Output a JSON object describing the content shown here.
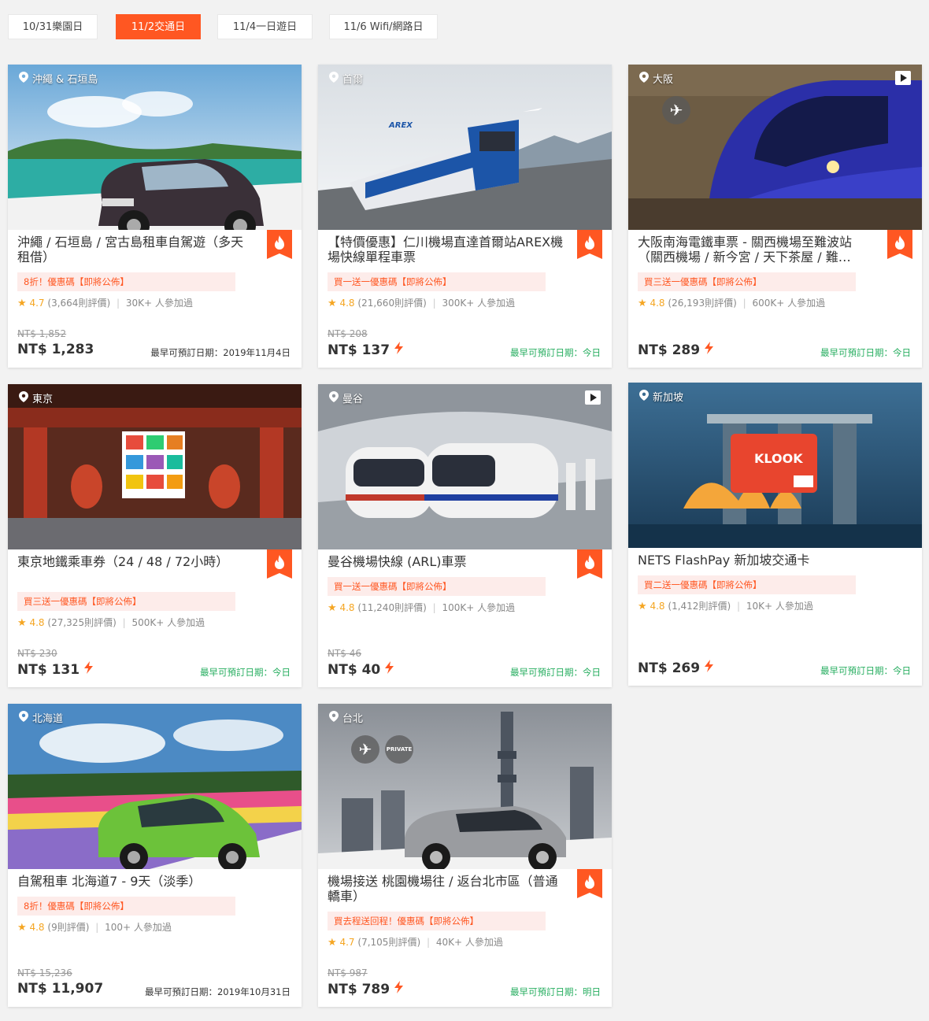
{
  "tabs": [
    {
      "label": "10/31樂園日",
      "active": false
    },
    {
      "label": "11/2交通日",
      "active": true
    },
    {
      "label": "11/4一日遊日",
      "active": false
    },
    {
      "label": "11/6 Wifi/網路日",
      "active": false
    }
  ],
  "colors": {
    "accent": "#ff5722",
    "promo_bg": "#fdecea",
    "star": "#f5a623",
    "green_date": "#27ae60"
  },
  "cards": [
    {
      "location": "沖繩 & 石垣島",
      "title": "沖繩 / 石垣島 / 宮古島租車自駕遊（多天租借）",
      "promo": "8折！優惠碼【即將公佈】",
      "score": "4.7",
      "reviews": "(3,664則評價)",
      "joined": "30K+ 人參加過",
      "old_price": "NT$ 1,852",
      "price": "NT$ 1,283",
      "instant": false,
      "date": "最早可預訂日期：2019年11月4日",
      "date_green": false,
      "hot": true,
      "video": false,
      "image_icon": "car-icon"
    },
    {
      "location": "首爾",
      "title": "【特價優惠】仁川機場直達首爾站AREX機場快線單程車票",
      "promo": "買一送一優惠碼【即將公佈】",
      "score": "4.8",
      "reviews": "(21,660則評價)",
      "joined": "300K+ 人參加過",
      "old_price": "NT$ 208",
      "price": "NT$ 137",
      "instant": true,
      "date": "最早可預訂日期：今日",
      "date_green": true,
      "hot": true,
      "video": false,
      "image_icon": "train-icon"
    },
    {
      "location": "大阪",
      "title": "大阪南海電鐵車票 - 關西機場至難波站（關西機場 / 新今宮 / 天下茶屋 / 難…",
      "promo": "買三送一優惠碼【即將公佈】",
      "score": "4.8",
      "reviews": "(26,193則評價)",
      "joined": "600K+ 人參加過",
      "old_price": "",
      "price": "NT$ 289",
      "instant": true,
      "date": "最早可預訂日期：今日",
      "date_green": true,
      "hot": true,
      "video": true,
      "image_icon": "train-icon"
    },
    {
      "location": "東京",
      "title": "東京地鐵乘車券（24 / 48 / 72小時）",
      "promo": "買三送一優惠碼【即將公佈】",
      "score": "4.8",
      "reviews": "(27,325則評價)",
      "joined": "500K+ 人參加過",
      "old_price": "NT$ 230",
      "price": "NT$ 131",
      "instant": true,
      "date": "最早可預訂日期：今日",
      "date_green": true,
      "hot": true,
      "video": false,
      "image_icon": "temple-icon"
    },
    {
      "location": "曼谷",
      "title": "曼谷機場快線 (ARL)車票",
      "promo": "買一送一優惠碼【即將公佈】",
      "score": "4.8",
      "reviews": "(11,240則評價)",
      "joined": "100K+ 人參加過",
      "old_price": "NT$ 46",
      "price": "NT$ 40",
      "instant": true,
      "date": "最早可預訂日期：今日",
      "date_green": true,
      "hot": true,
      "video": true,
      "image_icon": "train-icon"
    },
    {
      "location": "新加坡",
      "title": "NETS FlashPay 新加坡交通卡",
      "promo": "買二送一優惠碼【即將公佈】",
      "score": "4.8",
      "reviews": "(1,412則評價)",
      "joined": "10K+ 人參加過",
      "old_price": "",
      "price": "NT$ 269",
      "instant": true,
      "date": "最早可預訂日期：今日",
      "date_green": true,
      "hot": false,
      "video": false,
      "image_icon": "card-icon"
    },
    {
      "location": "北海道",
      "title": "自駕租車 北海道7 - 9天（淡季）",
      "promo": "8折！優惠碼【即將公佈】",
      "score": "4.8",
      "reviews": "(9則評價)",
      "joined": "100+ 人參加過",
      "old_price": "NT$ 15,236",
      "price": "NT$ 11,907",
      "instant": false,
      "date": "最早可預訂日期：2019年10月31日",
      "date_green": false,
      "hot": false,
      "video": false,
      "image_icon": "car-icon"
    },
    {
      "location": "台北",
      "title": "機場接送 桃園機場往 / 返台北市區（普通轎車）",
      "promo": "買去程送回程！優惠碼【即將公佈】",
      "score": "4.7",
      "reviews": "(7,105則評價)",
      "joined": "40K+ 人參加過",
      "old_price": "NT$ 987",
      "price": "NT$ 789",
      "instant": true,
      "date": "最早可預訂日期：明日",
      "date_green": true,
      "hot": true,
      "video": false,
      "image_icon": "car-icon",
      "private_label": "PRIVATE"
    }
  ]
}
